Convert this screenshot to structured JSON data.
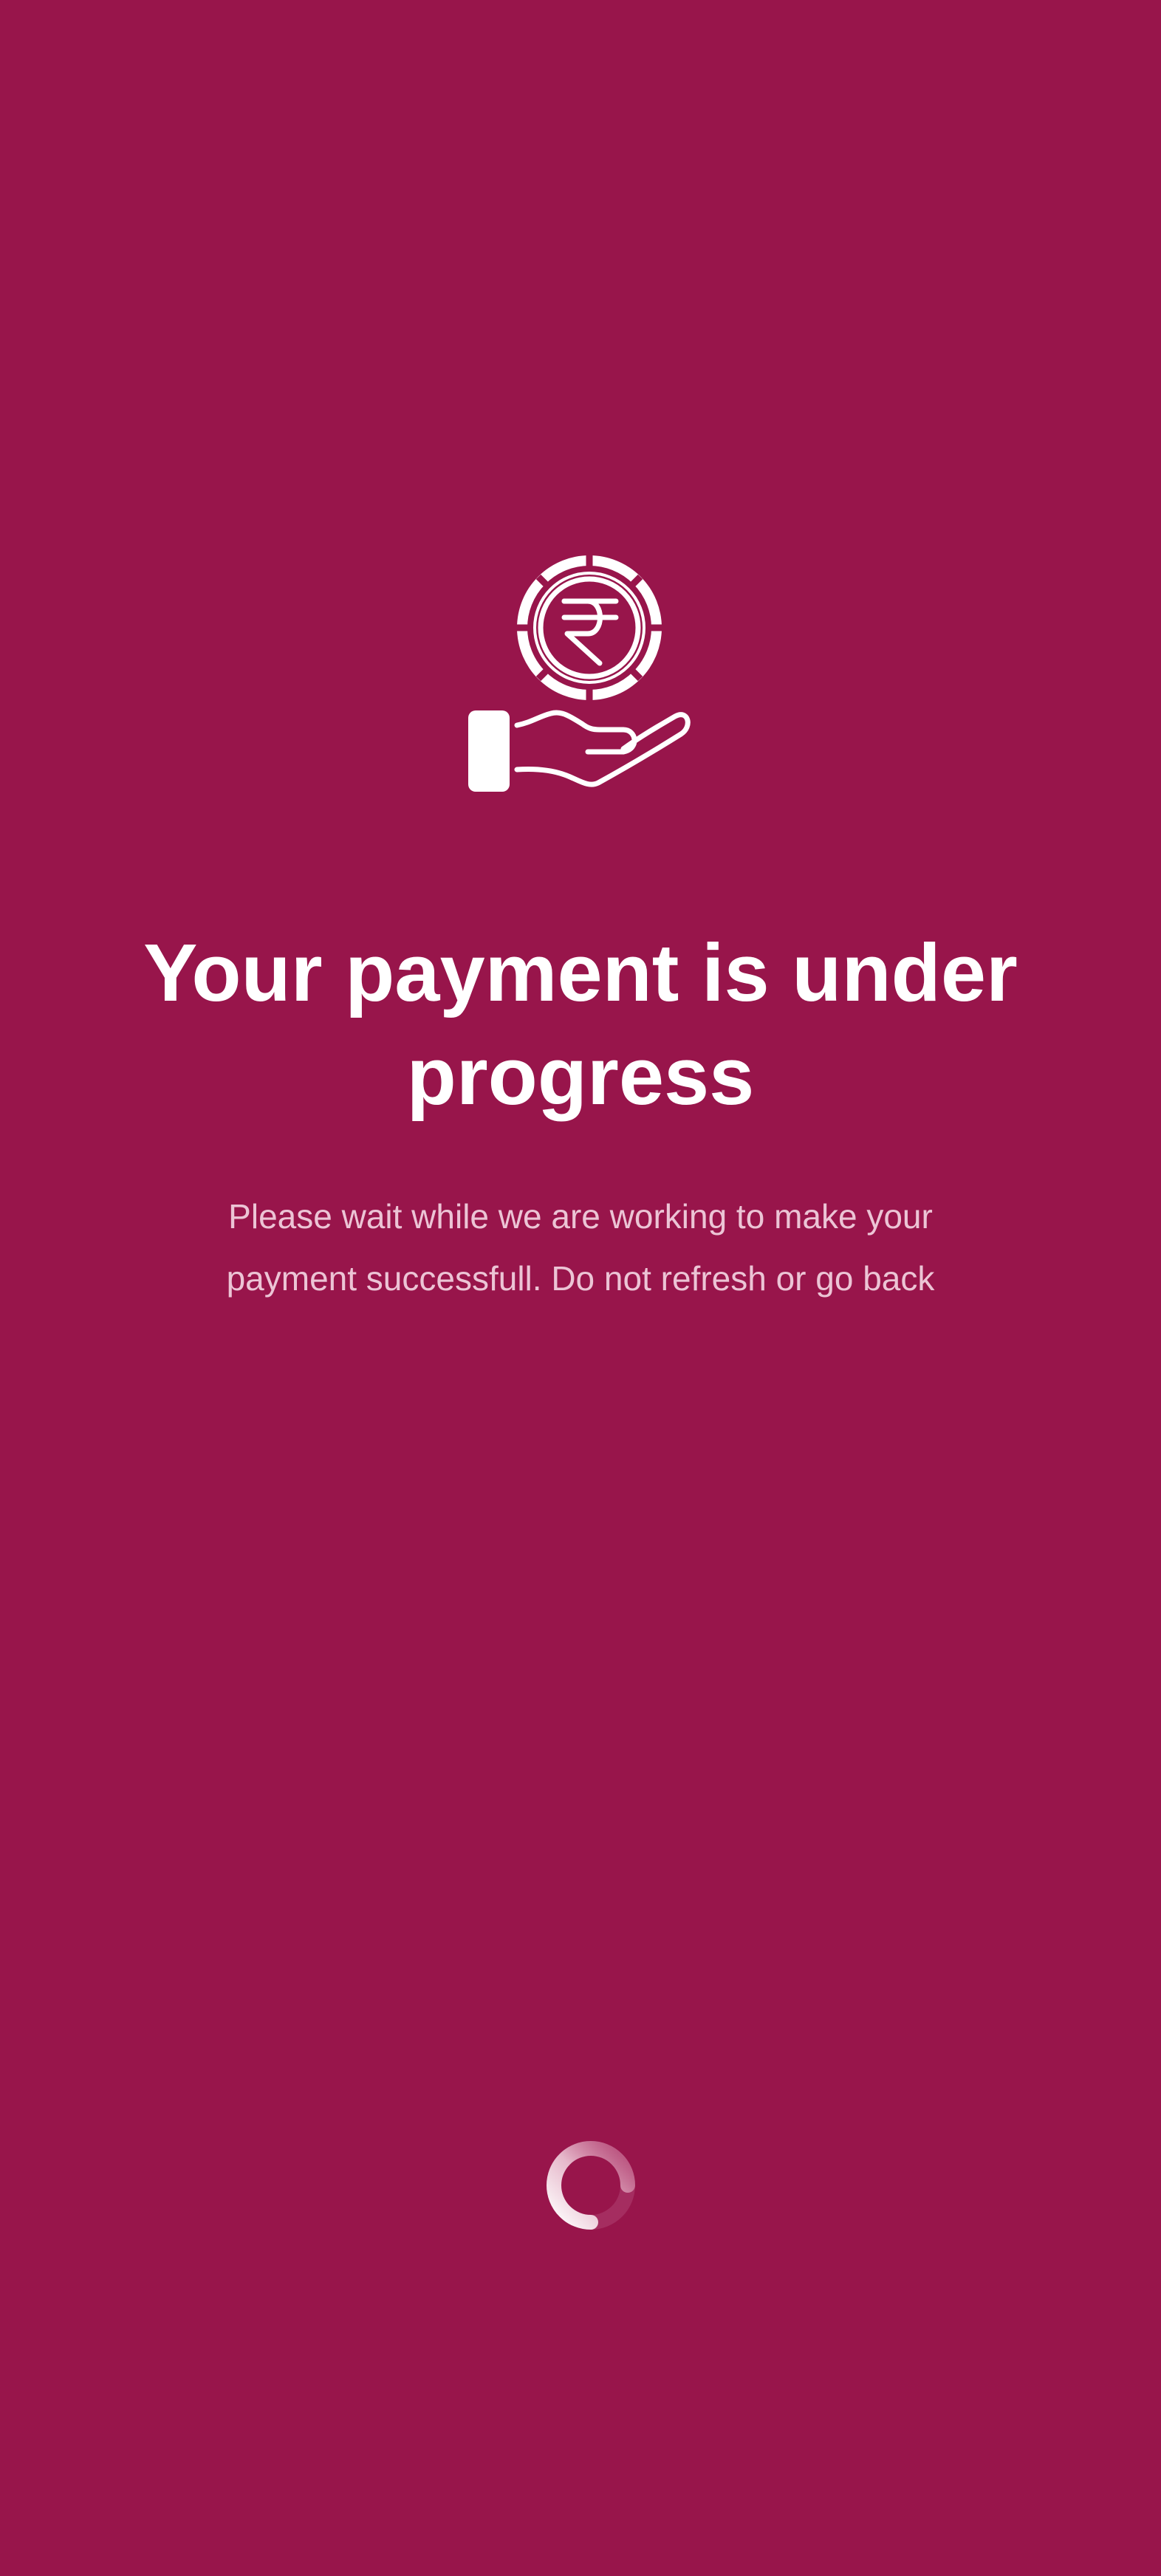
{
  "status": {
    "title": "Your payment is under progress",
    "message": "Please wait while we are working to make your payment successfull. Do not refresh or go back"
  },
  "icons": {
    "illustration": "hand-holding-rupee-coin-icon",
    "loader": "loading-spinner-icon"
  },
  "colors": {
    "background": "#98154b",
    "title_text": "#ffffff",
    "message_text": "#ecc4d5",
    "icon": "#ffffff"
  }
}
